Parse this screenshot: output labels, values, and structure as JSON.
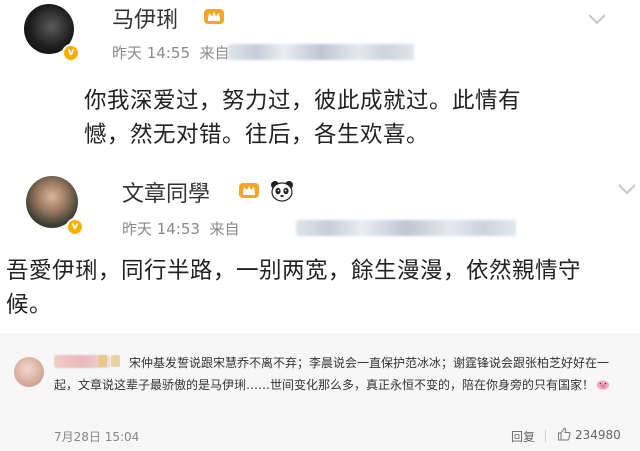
{
  "posts": [
    {
      "username": "马伊琍",
      "time": "昨天 14:55",
      "source_prefix": "来自",
      "body": "你我深爱过，努力过，彼此成就过。此情有憾，然无对错。往后，各生欢喜。"
    },
    {
      "username": "文章同學",
      "time": "昨天 14:53",
      "source_prefix": "来自",
      "body": "吾愛伊琍，同行半路，一别两宽，餘生漫漫，依然親情守候。"
    }
  ],
  "comment": {
    "text": "宋仲基发誓说跟宋慧乔不离不弃；李晨说会一直保护范冰冰；谢霆锋说会跟张柏芝好好在一起，文章说这辈子最骄傲的是马伊琍……世间变化那么多，真正永恒不变的，陪在你身旁的只有国家！",
    "time": "7月28日 15:04",
    "reply_label": "回复",
    "likes": "234980"
  },
  "colors": {
    "verified_badge": "#f6b100",
    "meta_gray": "#8a8a8a",
    "comment_bg": "#f7f7f7"
  },
  "icons": [
    "verified-badge-icon",
    "vip-crown-icon",
    "panda-emoji-icon",
    "chevron-down-icon",
    "pig-emoji-icon",
    "thumb-up-icon"
  ]
}
